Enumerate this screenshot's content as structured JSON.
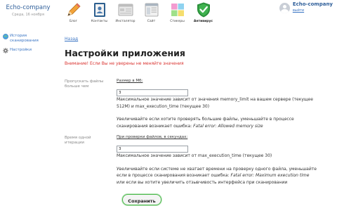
{
  "brand": {
    "name": "Echo-company",
    "date": "Среда, 16 ноября"
  },
  "toolbar": [
    {
      "label": "Блог",
      "icon": "pencil-icon"
    },
    {
      "label": "Контакты",
      "icon": "contacts-book-icon"
    },
    {
      "label": "Инсталятор",
      "icon": "installer-icon"
    },
    {
      "label": "Сайт",
      "icon": "site-icon"
    },
    {
      "label": "Стикеры",
      "icon": "stickers-icon"
    },
    {
      "label": "Антивирус",
      "icon": "antivirus-shield-icon",
      "active": true
    }
  ],
  "user": {
    "name": "Echo-company",
    "logout": "выйти"
  },
  "sidebar": [
    {
      "label_line1": "История",
      "label_line2": "сканирования",
      "icon": "scan-history-icon"
    },
    {
      "label_line1": "Настройки",
      "label_line2": "",
      "icon": "gear-icon"
    }
  ],
  "main": {
    "back": "Назад",
    "title": "Настройки приложения",
    "warning": "Внимание! Если Вы не уверены не меняйте значения",
    "size_row": {
      "label_line1": "Пропускать файлы",
      "label_line2": "больше чем",
      "caption": "Размер в Мб:",
      "value": "3",
      "note1": "Максимальное значение зависит от значения memory_limit на вашем сервере (текущее 512M) и max_execution_time (текущее 30)",
      "note2_text": "Увеличивайте если хотите проверять большие файлы, уменьшайте в процессе сканирования возникает ошибка:",
      "note2_error": "Fatal error: Allowed memory size"
    },
    "time_row": {
      "label_line1": "Время одной",
      "label_line2": "итерации",
      "caption": "При проверки файлов, в секундах:",
      "value": "3",
      "note1": "Максимальное значение зависит от max_execution_time (текущее 30)",
      "note2_text": "Увеличивайте если системе не хватает времени на проверку одного файла, уменьшайте если в процессе сканирования возникает ошибка:",
      "note2_error": "Fatal error: Maximum execution time",
      "note2_tail": "или если вы хотите увеличить отзывчивость интерфейса при сканировании"
    },
    "save": "Сохранить"
  },
  "colors": {
    "link": "#3c76c4",
    "warning": "#d9312e",
    "accent_green": "#4ab84a"
  }
}
